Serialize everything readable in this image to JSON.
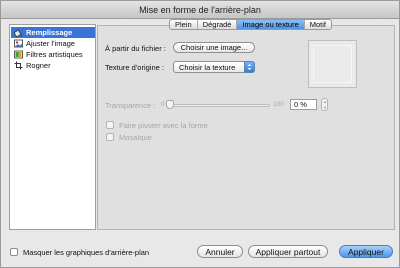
{
  "window": {
    "title": "Mise en forme de l'arrière-plan"
  },
  "sidebar": {
    "items": [
      {
        "label": "Remplissage",
        "icon": "paint-bucket-icon",
        "selected": true
      },
      {
        "label": "Ajuster l'image",
        "icon": "adjust-image-icon",
        "selected": false
      },
      {
        "label": "Filtres artistiques",
        "icon": "artistic-filter-icon",
        "selected": false
      },
      {
        "label": "Rogner",
        "icon": "crop-icon",
        "selected": false
      }
    ]
  },
  "tabs": [
    {
      "label": "Plein",
      "active": false
    },
    {
      "label": "Dégradé",
      "active": false
    },
    {
      "label": "Image ou texture",
      "active": true
    },
    {
      "label": "Motif",
      "active": false
    }
  ],
  "panel": {
    "from_file_label": "À partir du fichier :",
    "choose_image_button": "Choisir une image...",
    "original_texture_label": "Texture d'origine :",
    "texture_popup_value": "Choisir la texture",
    "transparency_label": "Transparence :",
    "slider_min": "0",
    "slider_max": "100",
    "transparency_value": "0 %",
    "rotate_with_shape_label": "Faire pivoter avec la forme",
    "tile_label": "Mosaïque"
  },
  "footer": {
    "hide_graphics_label": "Masquer les graphiques d'arrière-plan",
    "cancel_button": "Annuler",
    "apply_all_button": "Appliquer partout",
    "apply_button": "Appliquer"
  },
  "colors": {
    "selection": "#3875d7",
    "default_button": "#4c97e8",
    "disabled_text": "#a6a6a6"
  }
}
